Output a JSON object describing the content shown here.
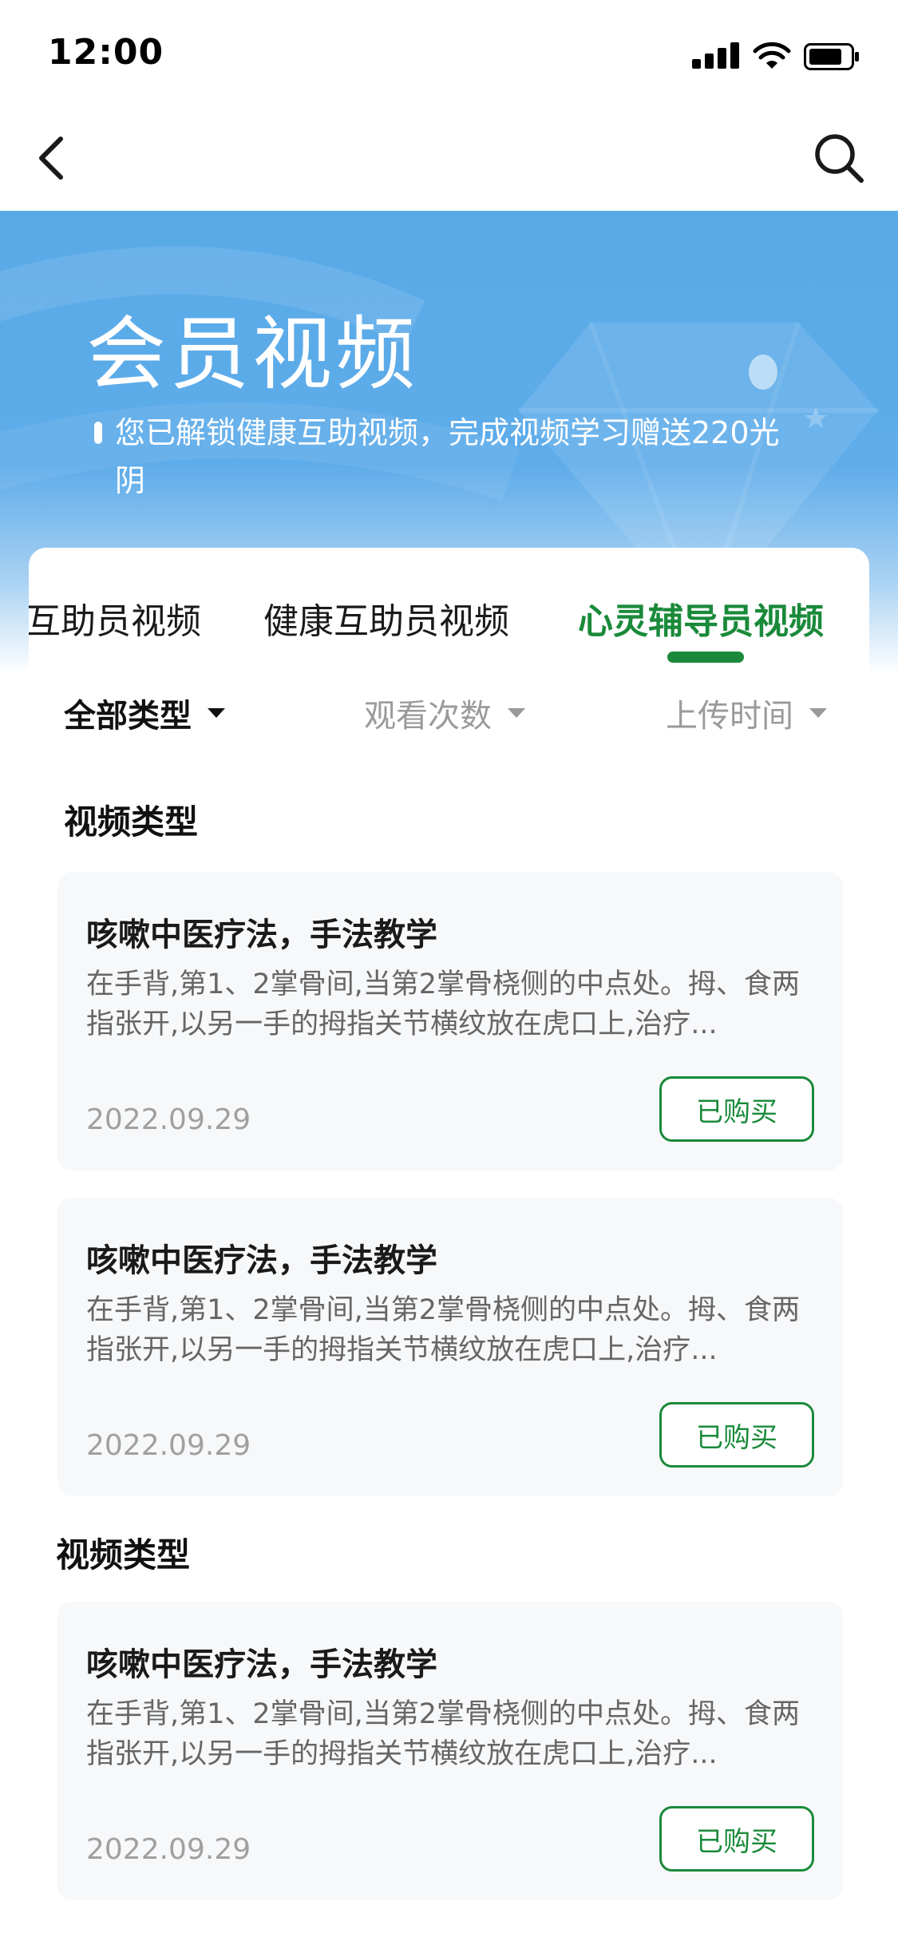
{
  "status_bar": {
    "time": "12:00"
  },
  "banner": {
    "title": "会员视频",
    "subtitle": "您已解锁健康互助视频，完成视频学习赠送220光阴"
  },
  "tabs": [
    {
      "label": "互助员视频",
      "active": false
    },
    {
      "label": "健康互助员视频",
      "active": false
    },
    {
      "label": "心灵辅导员视频",
      "active": true
    }
  ],
  "filters": [
    {
      "label": "全部类型",
      "active": true
    },
    {
      "label": "观看次数",
      "active": false
    },
    {
      "label": "上传时间",
      "active": false
    }
  ],
  "sections": [
    {
      "title": "视频类型",
      "videos": [
        {
          "title": "咳嗽中医疗法，手法教学",
          "description": "在手背,第1、2掌骨间,当第2掌骨桡侧的中点处。拇、食两指张开,以另一手的拇指关节横纹放在虎口上,治疗...",
          "date": "2022.09.29",
          "button": "已购买"
        },
        {
          "title": "咳嗽中医疗法，手法教学",
          "description": "在手背,第1、2掌骨间,当第2掌骨桡侧的中点处。拇、食两指张开,以另一手的拇指关节横纹放在虎口上,治疗...",
          "date": "2022.09.29",
          "button": "已购买"
        }
      ]
    },
    {
      "title": "视频类型",
      "videos": [
        {
          "title": "咳嗽中医疗法，手法教学",
          "description": "在手背,第1、2掌骨间,当第2掌骨桡侧的中点处。拇、食两指张开,以另一手的拇指关节横纹放在虎口上,治疗...",
          "date": "2022.09.29",
          "button": "已购买"
        }
      ]
    }
  ],
  "colors": {
    "accent": "#1a8a3a",
    "banner_blue": "#5aaae8",
    "card_bg": "#f7f8fa"
  },
  "icons": {
    "back": "chevron-left-icon",
    "search": "search-icon"
  }
}
